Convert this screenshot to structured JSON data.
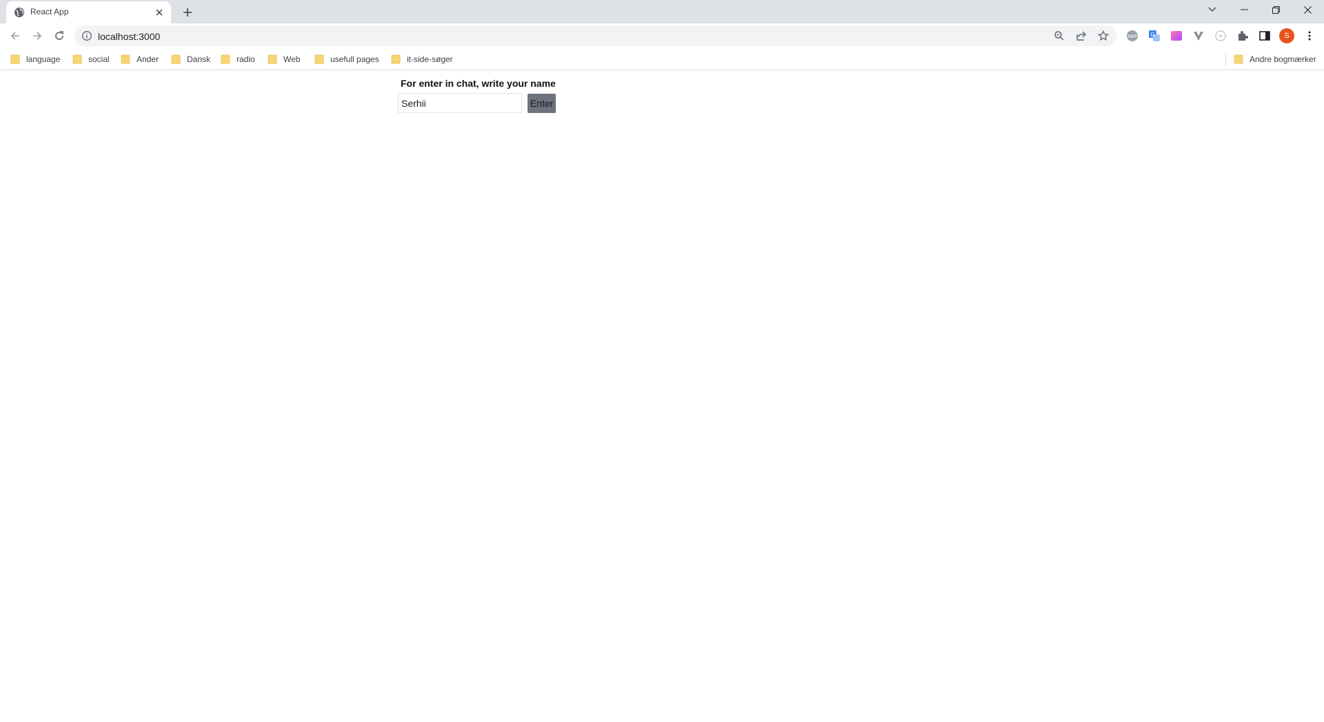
{
  "browser": {
    "tab": {
      "title": "React App",
      "favicon": "globe-icon"
    },
    "address_bar": {
      "url": "localhost:3000"
    },
    "profile_initial": "S",
    "bookmarks": [
      {
        "label": "language"
      },
      {
        "label": "social"
      },
      {
        "label": "Ander"
      },
      {
        "label": "Dansk"
      },
      {
        "label": "radio"
      },
      {
        "label": "Web"
      },
      {
        "label": "usefull pages"
      },
      {
        "label": "it-side-søger"
      }
    ],
    "other_bookmarks": "Andre bogmærker",
    "colors": {
      "tabstrip": "#dee1e6",
      "omnibox": "#f1f3f4",
      "folder": "#f9d572",
      "avatar": "#e8541e"
    }
  },
  "app": {
    "heading": "For enter in chat, write your name",
    "name_input": {
      "value": "Serhii"
    },
    "enter_button": "Enter",
    "colors": {
      "button_bg": "#6c737d"
    }
  }
}
